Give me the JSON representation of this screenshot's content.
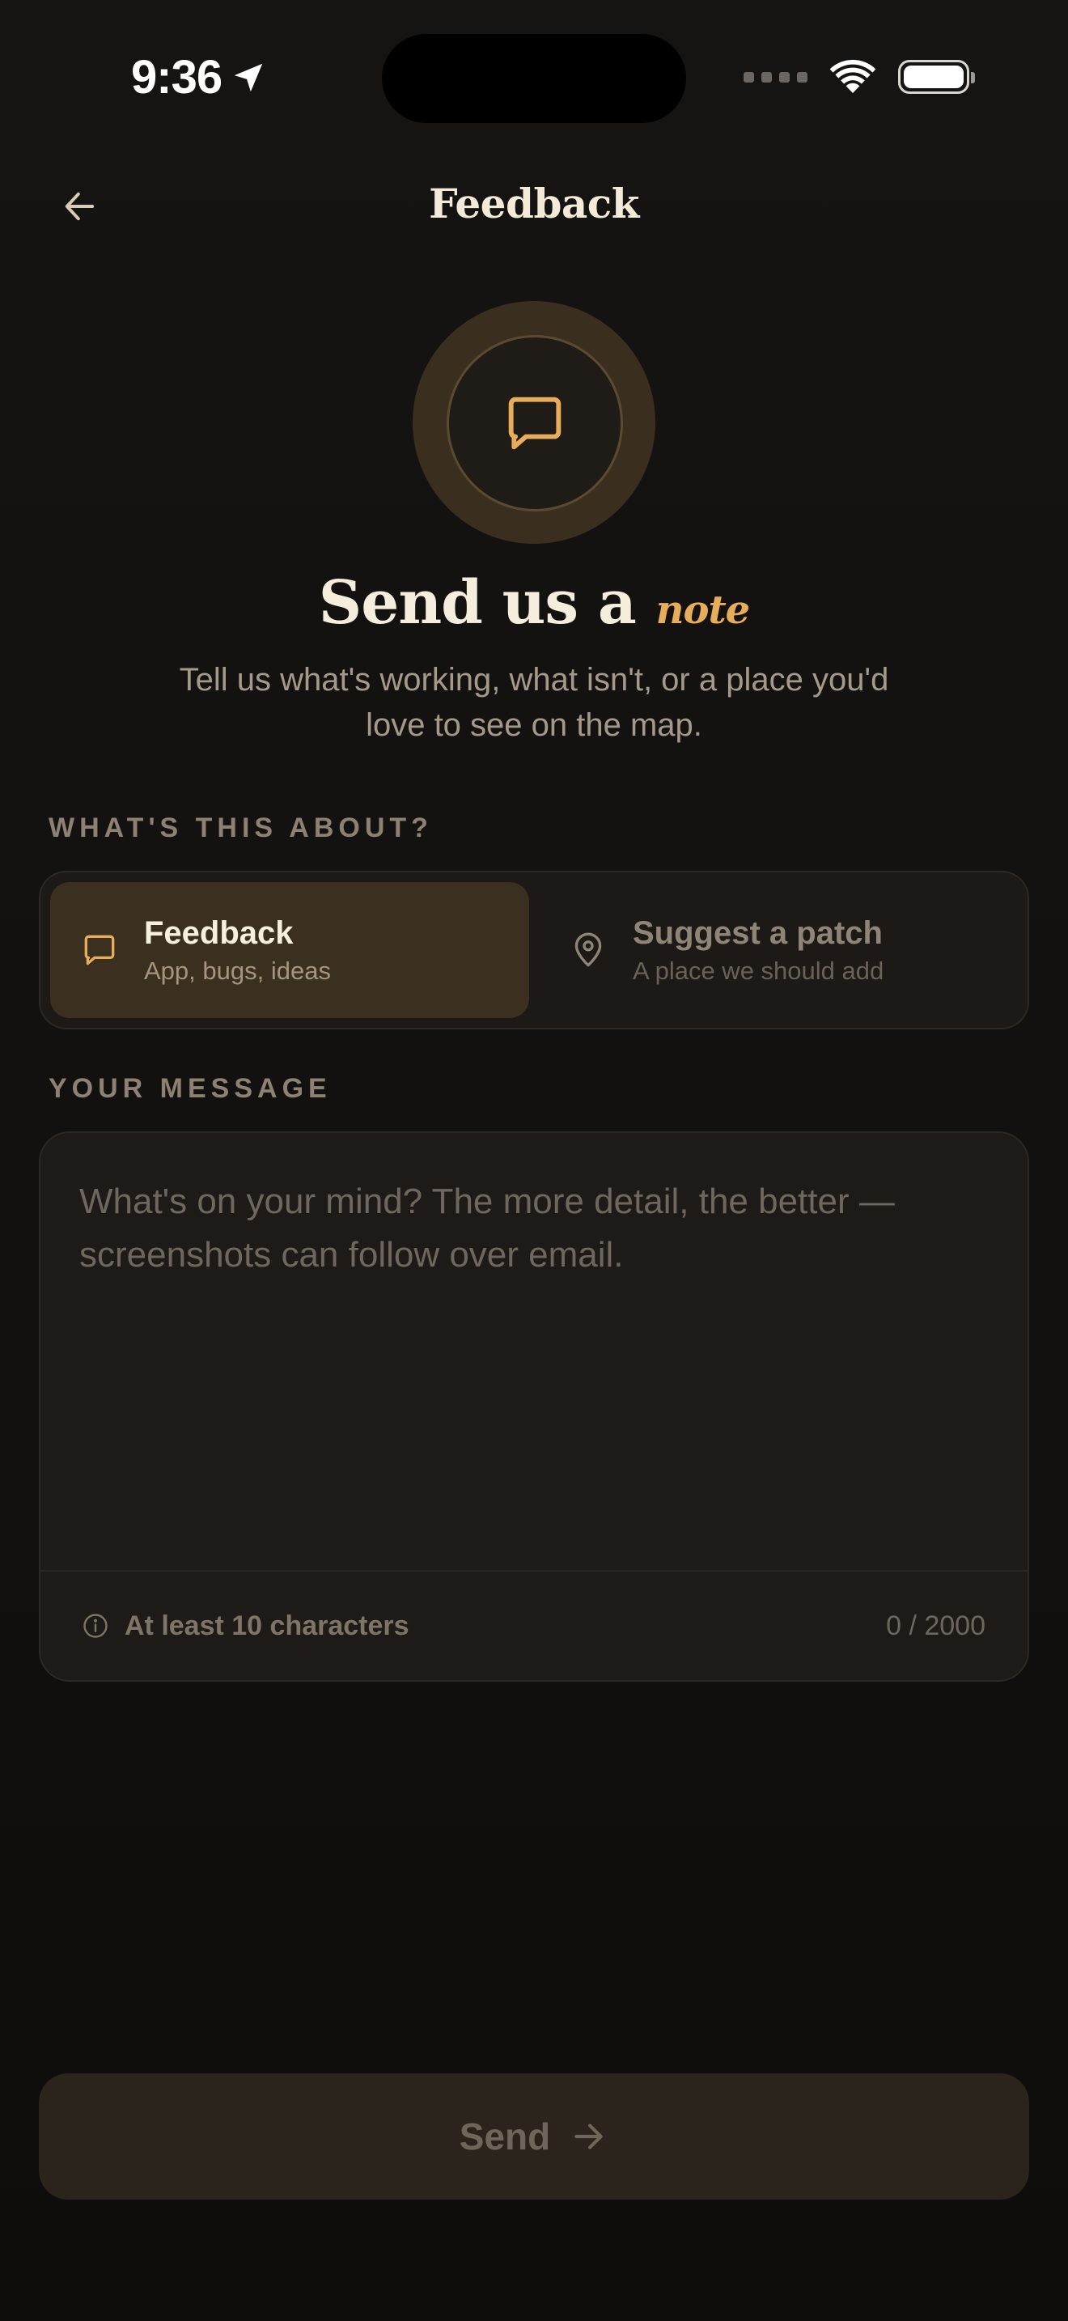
{
  "status_bar": {
    "time": "9:36"
  },
  "nav": {
    "title": "Feedback"
  },
  "hero": {
    "heading": "Send us a",
    "heading_accent": "note",
    "subtitle": "Tell us what's working, what isn't, or a place you'd love to see on the map."
  },
  "topic": {
    "label": "WHAT'S THIS ABOUT?",
    "options": [
      {
        "title": "Feedback",
        "description": "App, bugs, ideas",
        "icon": "chat-bubble-icon",
        "selected": true
      },
      {
        "title": "Suggest a patch",
        "description": "A place we should add",
        "icon": "map-pin-icon",
        "selected": false
      }
    ]
  },
  "message": {
    "label": "YOUR MESSAGE",
    "value": "",
    "placeholder": "What's on your mind? The more detail, the better — screenshots can follow over email.",
    "hint": "At least 10 characters",
    "counter": "0 / 2000"
  },
  "send": {
    "label": "Send"
  },
  "colors": {
    "background": "#141210",
    "accent": "#e7ad5a",
    "selected_option": "#3b301f",
    "text_primary": "#f3ead8",
    "text_muted": "#a59a8a"
  }
}
